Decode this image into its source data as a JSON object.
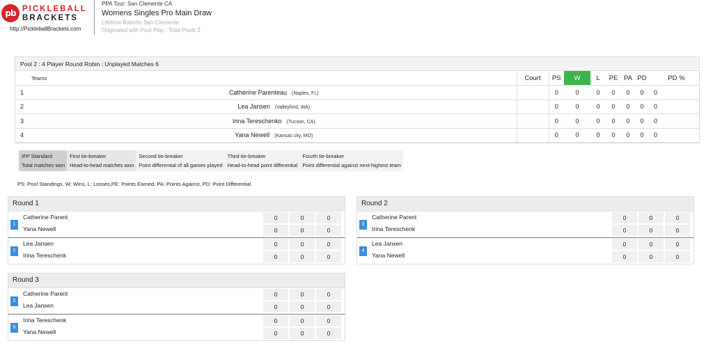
{
  "brand": {
    "logo_mark": "pb",
    "logo_word1": "PICKLEBALL",
    "logo_word2": "BRACKETS",
    "url": "http://PickleballBrackets.com",
    "accent": "#d8232a"
  },
  "header": {
    "tour": "PPA Tour: San Clemente CA",
    "event": "Womens Singles Pro Main Draw",
    "venue": "Lifetime Rancho San Clemente",
    "origin": "Originated with Pool Play : Total Pools 2"
  },
  "pool": {
    "title": "Pool 2 : 4 Player Round Robin : Unplayed Matches 6",
    "columns": {
      "teams": "Teams",
      "court": "Court",
      "ps": "PS",
      "w": "W",
      "l": "L",
      "pe": "PE",
      "pa": "PA",
      "pd": "PD",
      "pdp": "PD %"
    },
    "rows": [
      {
        "num": "1",
        "name": "Catherine Parenteau",
        "loc": "(Naples, FL)",
        "court": "",
        "ps": "0",
        "w": "0",
        "l": "0",
        "pe": "0",
        "pa": "0",
        "pd": "0",
        "pdp": "0"
      },
      {
        "num": "2",
        "name": "Lea Jansen",
        "loc": "(Valleyford, WA)",
        "court": "",
        "ps": "0",
        "w": "0",
        "l": "0",
        "pe": "0",
        "pa": "0",
        "pd": "0",
        "pdp": "0"
      },
      {
        "num": "3",
        "name": "Irina Tereschenko",
        "loc": "(Tucson, CA)",
        "court": "",
        "ps": "0",
        "w": "0",
        "l": "0",
        "pe": "0",
        "pa": "0",
        "pd": "0",
        "pdp": "0"
      },
      {
        "num": "4",
        "name": "Yana Newell",
        "loc": "(Kansas city, MO)",
        "court": "",
        "ps": "0",
        "w": "0",
        "l": "0",
        "pe": "0",
        "pa": "0",
        "pd": "0",
        "pdp": "0"
      }
    ],
    "win_color": "#3bb54a"
  },
  "tiebreakers": [
    {
      "label": "IFP Standard",
      "value": "Total matches won"
    },
    {
      "label": "First tie-breaker",
      "value": "Head-to-head matches won"
    },
    {
      "label": "Second tie-breaker",
      "value": "Point differential of all games played"
    },
    {
      "label": "Third tie-breaker",
      "value": "Head-to-head point differential"
    },
    {
      "label": "Fourth tie-breaker",
      "value": "Point differential against next-highest team"
    }
  ],
  "legend": "PS: Pool Standings, W: Wins, L: Losses,PE: Points Earned, PA: Points Against, PD: Point Differential",
  "rounds": [
    {
      "title": "Round 1",
      "matches": [
        {
          "num": "1",
          "p1": "Catherine Parent",
          "p2": "Yana Newell",
          "s1": [
            "0",
            "0",
            "0"
          ],
          "s2": [
            "0",
            "0",
            "0"
          ]
        },
        {
          "num": "2",
          "p1": "Lea Jansen",
          "p2": "Irina Tereschenk",
          "s1": [
            "0",
            "0",
            "0"
          ],
          "s2": [
            "0",
            "0",
            "0"
          ]
        }
      ]
    },
    {
      "title": "Round 2",
      "matches": [
        {
          "num": "3",
          "p1": "Catherine Parent",
          "p2": "Irina Tereschenk",
          "s1": [
            "0",
            "0",
            "0"
          ],
          "s2": [
            "0",
            "0",
            "0"
          ]
        },
        {
          "num": "4",
          "p1": "Lea Jansen",
          "p2": "Yana Newell",
          "s1": [
            "0",
            "0",
            "0"
          ],
          "s2": [
            "0",
            "0",
            "0"
          ]
        }
      ]
    },
    {
      "title": "Round 3",
      "matches": [
        {
          "num": "5",
          "p1": "Catherine Parent",
          "p2": "Lea Jansen",
          "s1": [
            "0",
            "0",
            "0"
          ],
          "s2": [
            "0",
            "0",
            "0"
          ]
        },
        {
          "num": "6",
          "p1": "Irina Tereschenk",
          "p2": "Yana Newell",
          "s1": [
            "0",
            "0",
            "0"
          ],
          "s2": [
            "0",
            "0",
            "0"
          ]
        }
      ]
    }
  ],
  "match_badge_color": "#3a8de0"
}
